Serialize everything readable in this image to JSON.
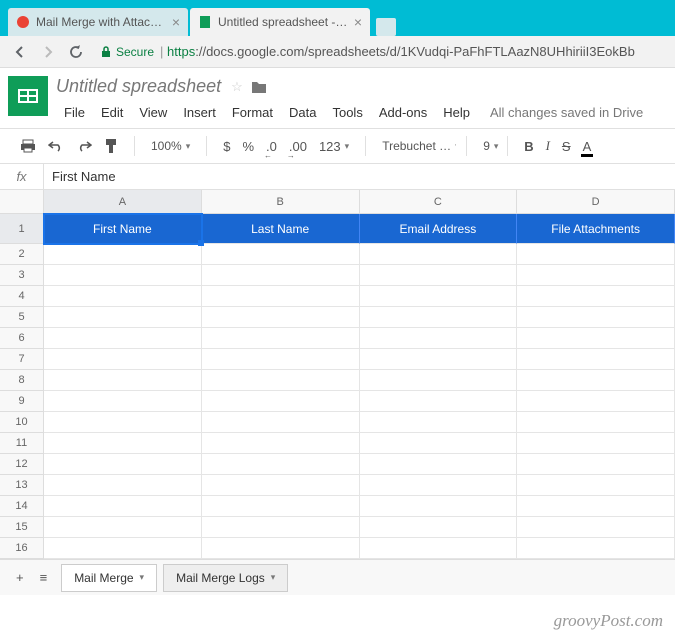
{
  "browser": {
    "tabs": [
      {
        "title": "Mail Merge with Attachm"
      },
      {
        "title": "Untitled spreadsheet - G"
      }
    ],
    "url_secure_label": "Secure",
    "url_https": "https",
    "url_rest": "://docs.google.com/spreadsheets/d/1KVudqi-PaFhFTLAazN8UHhiriiI3EokBb"
  },
  "doc": {
    "title": "Untitled spreadsheet",
    "menus": [
      "File",
      "Edit",
      "View",
      "Insert",
      "Format",
      "Data",
      "Tools",
      "Add-ons",
      "Help"
    ],
    "save_status": "All changes saved in Drive"
  },
  "toolbar": {
    "zoom": "100%",
    "currency": "$",
    "percent": "%",
    "dec_dec": ".0",
    "dec_inc": ".00",
    "more_formats": "123",
    "font": "Trebuchet …",
    "font_size": "9",
    "bold": "B",
    "italic": "I",
    "strike": "S",
    "color": "A"
  },
  "fx": {
    "label": "fx",
    "value": "First Name"
  },
  "grid": {
    "cols": [
      "A",
      "B",
      "C",
      "D"
    ],
    "headers": [
      "First Name",
      "Last Name",
      "Email Address",
      "File Attachments"
    ],
    "rows": 16
  },
  "sheets": {
    "tabs": [
      "Mail Merge",
      "Mail Merge Logs"
    ]
  },
  "watermark": "groovyPost.com"
}
